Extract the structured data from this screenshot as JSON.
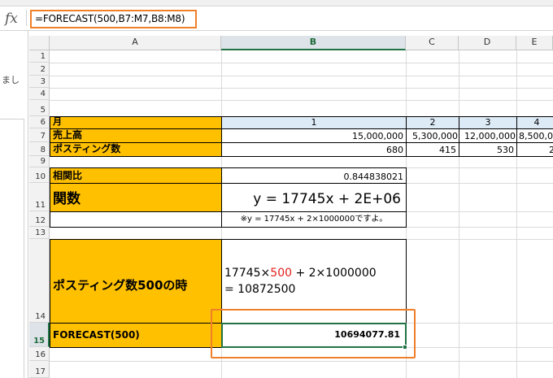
{
  "formula_bar": {
    "fx_label": "fx",
    "formula": "=FORECAST(500,B7:M7,B8:M8)"
  },
  "side_panel": {
    "text": "まし"
  },
  "columns": [
    "A",
    "B",
    "C",
    "D",
    "E"
  ],
  "rows": [
    "1",
    "2",
    "3",
    "4",
    "5",
    "6",
    "7",
    "8",
    "9",
    "10",
    "11",
    "12",
    "13",
    "14",
    "15",
    "16",
    "17"
  ],
  "sheet": {
    "row6": {
      "label": "月",
      "b": "1",
      "c": "2",
      "d": "3",
      "e": "4"
    },
    "row7": {
      "label": "売上高",
      "b": "15,000,000",
      "c": "5,300,000",
      "d": "12,000,000",
      "e": "8,500,0"
    },
    "row8": {
      "label": "ポスティング数",
      "b": "680",
      "c": "415",
      "d": "530",
      "e": "2"
    },
    "row10": {
      "label": "相関比",
      "b": "0.844838021"
    },
    "row11": {
      "label": "関数",
      "b": "y = 17745x + 2E+06"
    },
    "row12": {
      "b": "※y = 17745x + 2×1000000ですよ。"
    },
    "row14": {
      "label": "ポスティング数500の時",
      "line1_prefix": "17745×",
      "line1_red": "500",
      "line1_suffix": " + 2×1000000",
      "line2": "= 10872500"
    },
    "row15": {
      "label": "FORECAST(500)",
      "b": "10694077.81"
    }
  },
  "colors": {
    "accent_orange": "#f07f2a",
    "label_fill": "#ffc000",
    "header_fill": "#ddebf7",
    "selection_green": "#217346",
    "highlight_red": "#e0201b"
  }
}
